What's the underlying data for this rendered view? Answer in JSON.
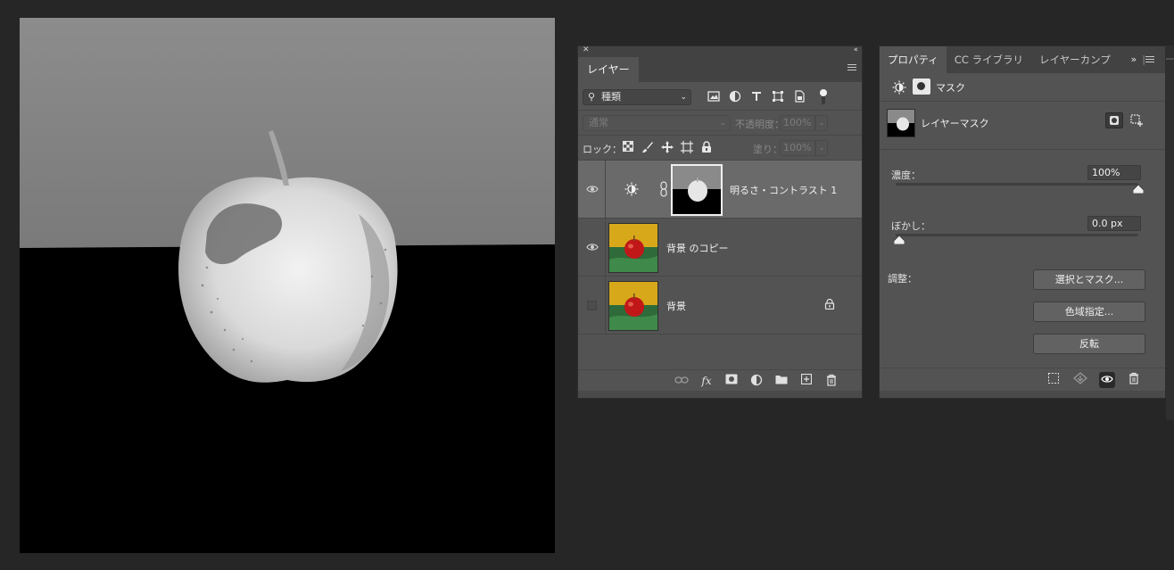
{
  "layers_panel": {
    "tab_label": "レイヤー",
    "filter": {
      "selected": "種類"
    },
    "blend_mode": "通常",
    "opacity_label": "不透明度：",
    "opacity_value": "100%",
    "lock_label": "ロック：",
    "fill_label": "塗り：",
    "fill_value": "100%",
    "layers": [
      {
        "name": "明るさ・コントラスト 1",
        "visible": true,
        "selected": true,
        "type": "adjustment"
      },
      {
        "name": "背景 のコピー",
        "visible": true,
        "selected": false,
        "type": "pixel"
      },
      {
        "name": "背景",
        "visible": false,
        "selected": false,
        "type": "pixel",
        "locked": true
      }
    ]
  },
  "properties_panel": {
    "tabs": [
      {
        "label": "プロパティ",
        "active": true
      },
      {
        "label": "CC ライブラリ",
        "active": false
      },
      {
        "label": "レイヤーカンプ",
        "active": false
      }
    ],
    "overflow_label": "»",
    "header_title": "マスク",
    "mask_label": "レイヤーマスク",
    "density_label": "濃度：",
    "density_value": "100%",
    "density_level": 1.0,
    "feather_label": "ぼかし：",
    "feather_value": "0.0 px",
    "feather_level": 0.0,
    "adjust_label": "調整：",
    "buttons": {
      "select_mask": "選択とマスク...",
      "color_range": "色域指定...",
      "invert": "反転"
    }
  },
  "colors": {
    "app_bg": "#262626",
    "panel_bg": "#535353",
    "selected_layer_bg": "#6a6a6a",
    "tab_bar": "#424242"
  }
}
